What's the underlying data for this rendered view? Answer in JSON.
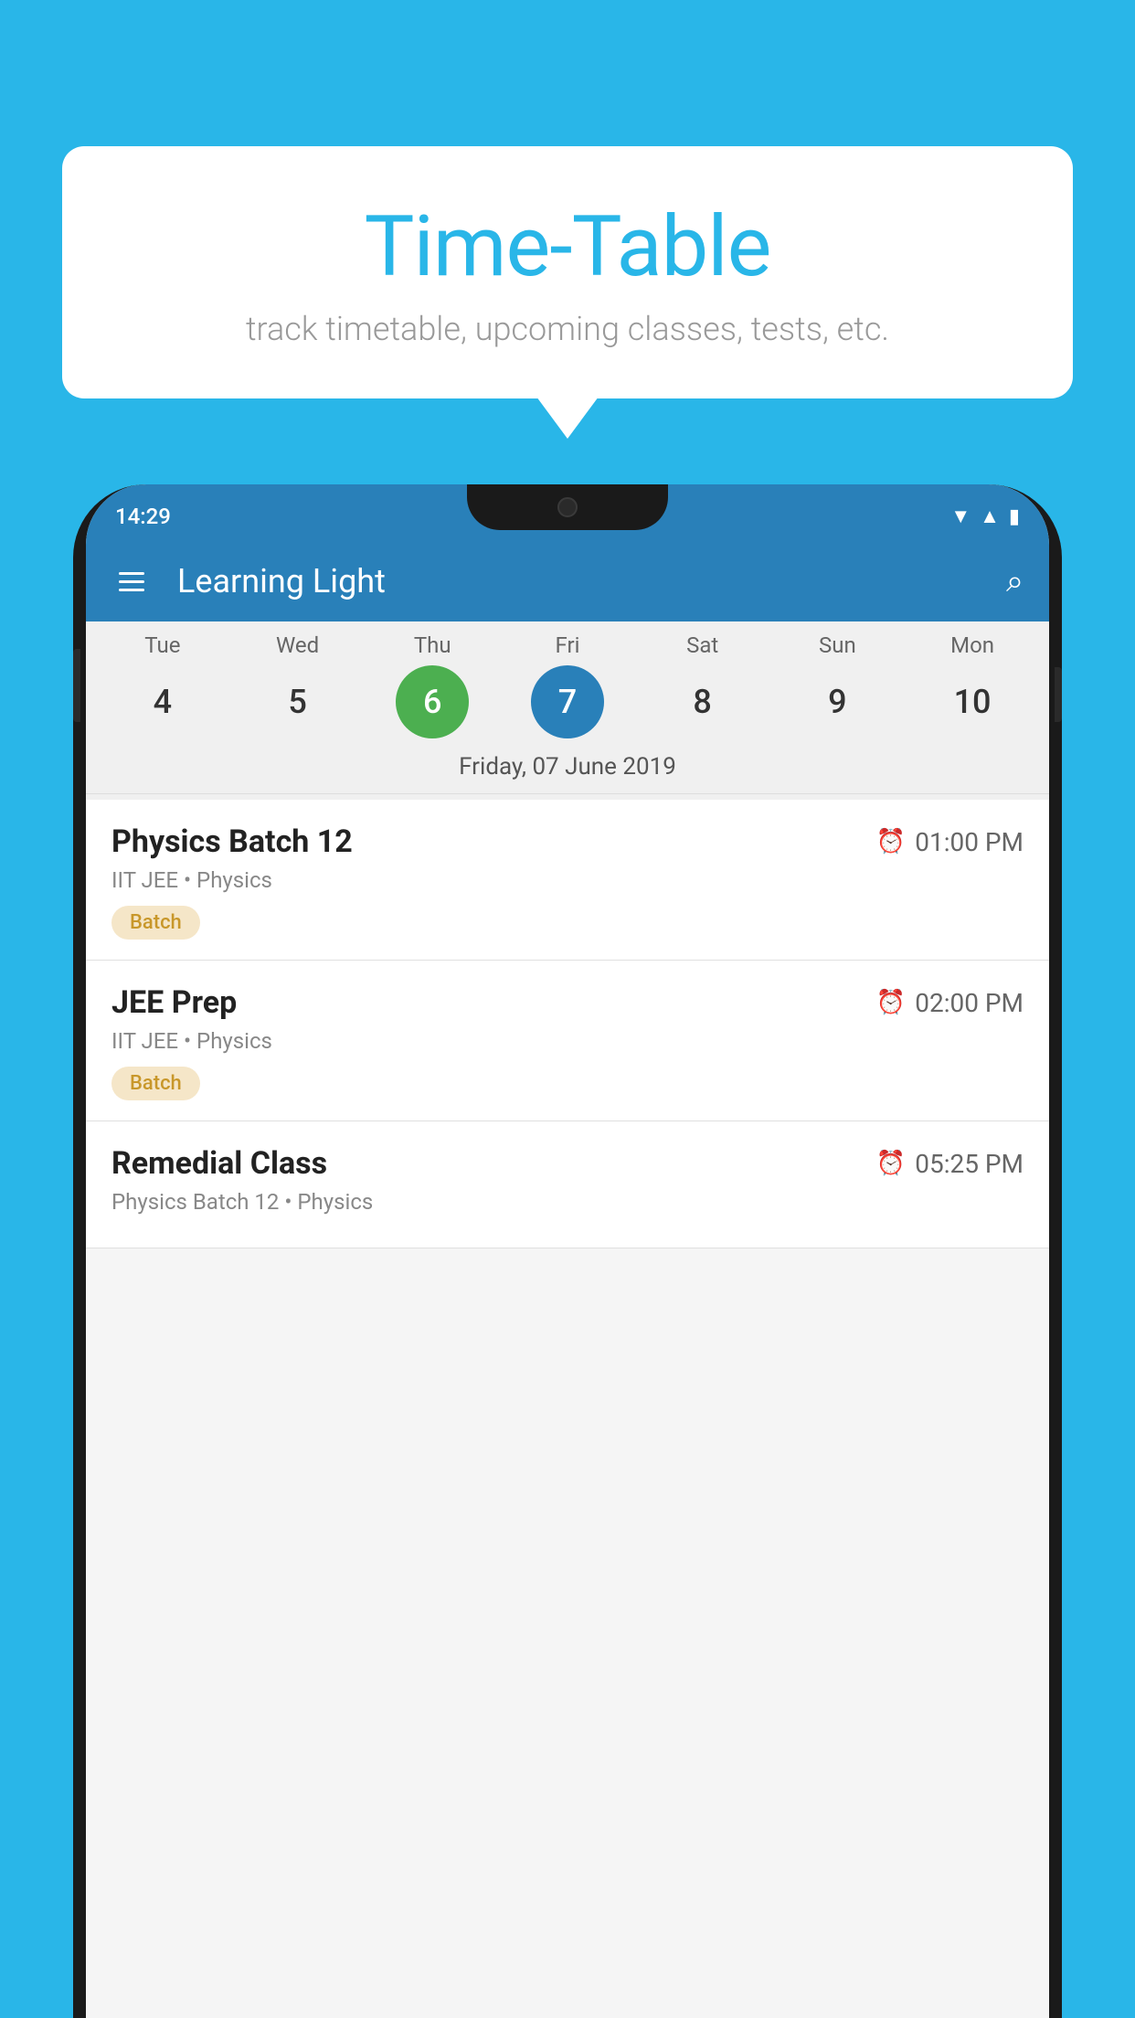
{
  "background_color": "#29b6e8",
  "bubble": {
    "title": "Time-Table",
    "subtitle": "track timetable, upcoming classes, tests, etc."
  },
  "phone": {
    "status_bar": {
      "time": "14:29"
    },
    "toolbar": {
      "app_name": "Learning Light"
    },
    "calendar": {
      "selected_date_label": "Friday, 07 June 2019",
      "days": [
        {
          "label": "Tue",
          "number": "4",
          "state": "normal"
        },
        {
          "label": "Wed",
          "number": "5",
          "state": "normal"
        },
        {
          "label": "Thu",
          "number": "6",
          "state": "today"
        },
        {
          "label": "Fri",
          "number": "7",
          "state": "selected"
        },
        {
          "label": "Sat",
          "number": "8",
          "state": "normal"
        },
        {
          "label": "Sun",
          "number": "9",
          "state": "normal"
        },
        {
          "label": "Mon",
          "number": "10",
          "state": "normal"
        }
      ]
    },
    "schedule": [
      {
        "title": "Physics Batch 12",
        "time": "01:00 PM",
        "subtitle": "IIT JEE • Physics",
        "badge": "Batch"
      },
      {
        "title": "JEE Prep",
        "time": "02:00 PM",
        "subtitle": "IIT JEE • Physics",
        "badge": "Batch"
      },
      {
        "title": "Remedial Class",
        "time": "05:25 PM",
        "subtitle": "Physics Batch 12 • Physics",
        "badge": ""
      }
    ]
  }
}
